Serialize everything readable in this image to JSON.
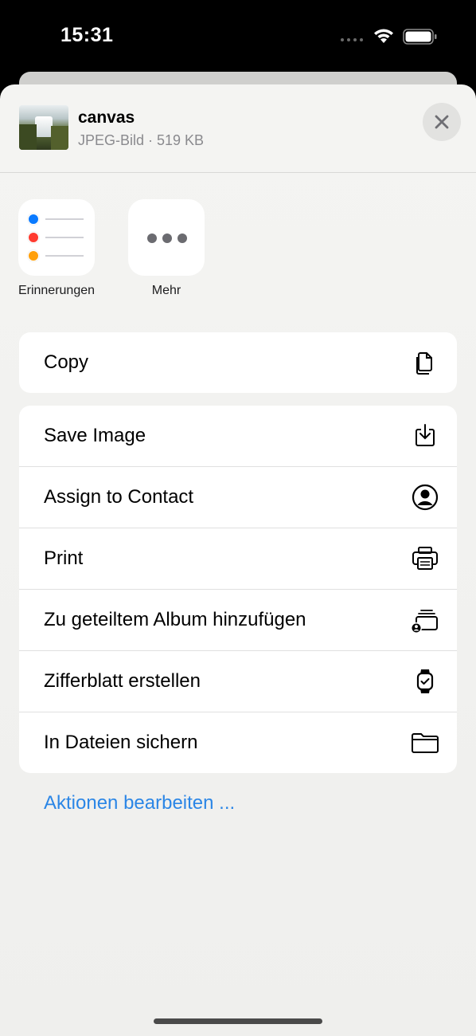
{
  "status_bar": {
    "time": "15:31",
    "icons": [
      "signal-dots-icon",
      "wifi-icon",
      "battery-icon"
    ]
  },
  "share_sheet": {
    "file": {
      "name": "canvas",
      "meta": "JPEG-Bild · 519 KB"
    },
    "close_icon": "close-icon",
    "apps": [
      {
        "label": "Erinnerungen",
        "icon": "reminders-icon"
      },
      {
        "label": "Mehr",
        "icon": "more-icon"
      }
    ],
    "reminder_colors": [
      "#0a7aff",
      "#ff3b30",
      "#ff9f0a"
    ],
    "actions_group1": [
      {
        "label": "Copy",
        "icon": "copy-icon"
      }
    ],
    "actions_group2": [
      {
        "label": "Save Image",
        "icon": "save-image-icon"
      },
      {
        "label": "Assign to Contact",
        "icon": "contact-icon"
      },
      {
        "label": "Print",
        "icon": "printer-icon"
      },
      {
        "label": "Zu geteiltem Album hinzufügen",
        "icon": "shared-album-icon"
      },
      {
        "label": "Zifferblatt erstellen",
        "icon": "watch-icon"
      },
      {
        "label": "In Dateien sichern",
        "icon": "folder-icon"
      }
    ],
    "edit_actions_label": "Aktionen bearbeiten ...",
    "accent_color": "#2b86e6"
  }
}
